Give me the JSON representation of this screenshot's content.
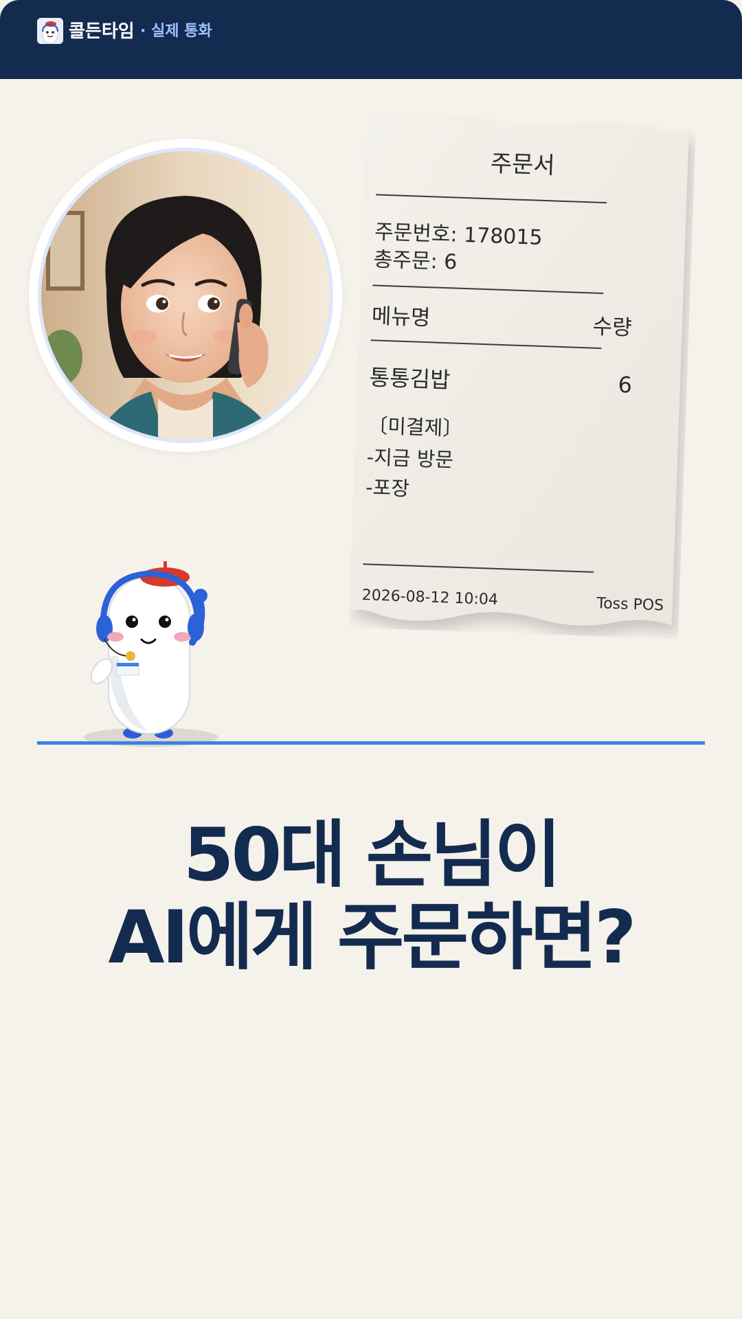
{
  "header": {
    "brand_name": "콜든타임",
    "brand_tag": "· 실제 통화",
    "background": "#132b4f",
    "tag_color": "#9ec1ff"
  },
  "portrait": {
    "icon": "woman-on-phone-portrait"
  },
  "receipt": {
    "title": "주문서",
    "order_number": "주문번호: 178015",
    "total_orders": "총주문: 6",
    "col_menu": "메뉴명",
    "col_qty": "수량",
    "item_name": "통통김밥",
    "item_qty": "6",
    "notes": [
      "〔미결제〕",
      "-지금 방문",
      "-포장"
    ],
    "datetime": "2026-08-12 10:04",
    "pos": "Toss POS"
  },
  "mascot": {
    "icon": "headset-mascot-icon"
  },
  "divider_color": "#3a82e8",
  "headline": {
    "line1": "50대 손님이",
    "line2": "AI에게 주문하면?",
    "color": "#132b4f"
  }
}
